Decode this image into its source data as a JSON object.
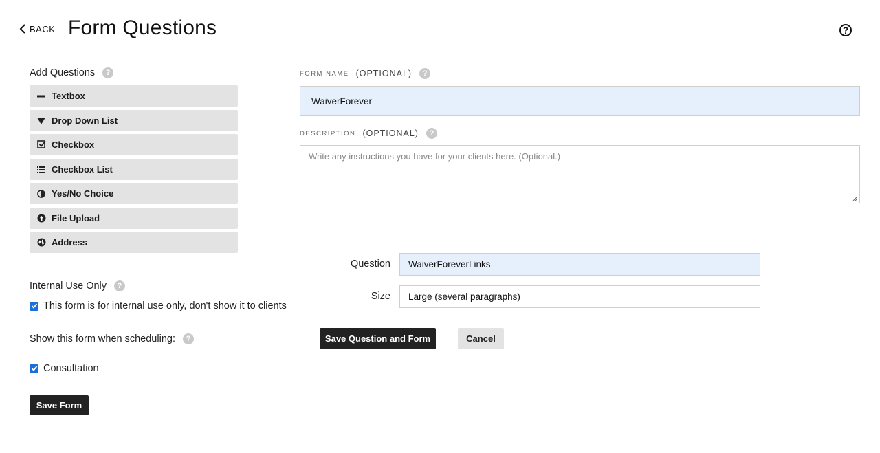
{
  "header": {
    "back_label": "BACK",
    "title": "Form Questions"
  },
  "add_questions": {
    "label": "Add Questions",
    "items": [
      {
        "label": "Textbox",
        "icon": "minus-icon"
      },
      {
        "label": "Drop Down List",
        "icon": "triangle-down-icon"
      },
      {
        "label": "Checkbox",
        "icon": "checkbox-icon"
      },
      {
        "label": "Checkbox List",
        "icon": "list-icon"
      },
      {
        "label": "Yes/No Choice",
        "icon": "half-circle-icon"
      },
      {
        "label": "File Upload",
        "icon": "upload-icon"
      },
      {
        "label": "Address",
        "icon": "globe-icon"
      }
    ]
  },
  "internal_use": {
    "label": "Internal Use Only",
    "checkbox_label": "This form is for internal use only, don't show it to clients",
    "checked": true
  },
  "scheduling": {
    "label": "Show this form when scheduling:",
    "option_label": "Consultation",
    "checked": true
  },
  "save_form_label": "Save Form",
  "form_name": {
    "label": "FORM NAME",
    "optional": "(OPTIONAL)",
    "value": "WaiverForever"
  },
  "description": {
    "label": "DESCRIPTION",
    "optional": "(OPTIONAL)",
    "placeholder": "Write any instructions you have for your clients here. (Optional.)"
  },
  "question": {
    "label": "Question",
    "value": "WaiverForeverLinks"
  },
  "size": {
    "label": "Size",
    "value": "Large (several paragraphs)"
  },
  "actions": {
    "save_label": "Save Question and Form",
    "cancel_label": "Cancel"
  },
  "colors": {
    "accent": "#1a6fd8",
    "filled_input": "#e6effc",
    "dark_button": "#222222",
    "light_button": "#e3e3e3"
  }
}
